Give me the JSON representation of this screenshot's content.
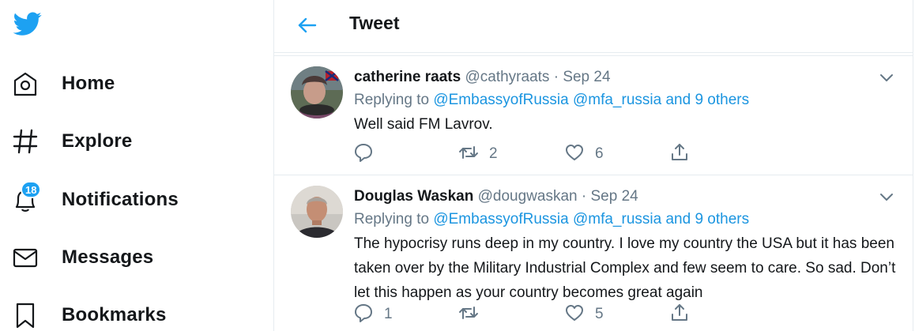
{
  "colors": {
    "accent": "#1da1f2",
    "link": "#1b95e0",
    "muted": "#657786",
    "text": "#14171a"
  },
  "sidebar": {
    "logo_icon": "twitter-bird-icon",
    "items": [
      {
        "label": "Home",
        "icon": "home-icon"
      },
      {
        "label": "Explore",
        "icon": "hashtag-icon"
      },
      {
        "label": "Notifications",
        "icon": "bell-icon",
        "badge": "18"
      },
      {
        "label": "Messages",
        "icon": "envelope-icon"
      },
      {
        "label": "Bookmarks",
        "icon": "bookmark-icon"
      }
    ]
  },
  "header": {
    "title": "Tweet",
    "back_icon": "back-arrow-icon"
  },
  "tweets": [
    {
      "name": "catherine raats",
      "handle": "@cathyraats",
      "dot": "·",
      "date": "Sep 24",
      "replying_prefix": "Replying to",
      "replying_1": "@EmbassyofRussia",
      "replying_2": "@mfa_russia",
      "replying_others": "and 9 others",
      "text": "Well said FM Lavrov.",
      "replies": "",
      "retweets": "2",
      "likes": "6"
    },
    {
      "name": "Douglas Waskan",
      "handle": "@dougwaskan",
      "dot": "·",
      "date": "Sep 24",
      "replying_prefix": "Replying to",
      "replying_1": "@EmbassyofRussia",
      "replying_2": "@mfa_russia",
      "replying_others": "and 9 others",
      "text": "The hypocrisy runs deep in my country.  I love my country the USA but it has been taken over by the Military Industrial Complex and few seem to care.  So sad. Don’t let this happen as your country becomes great again",
      "replies": "1",
      "retweets": "",
      "likes": "5"
    }
  ]
}
